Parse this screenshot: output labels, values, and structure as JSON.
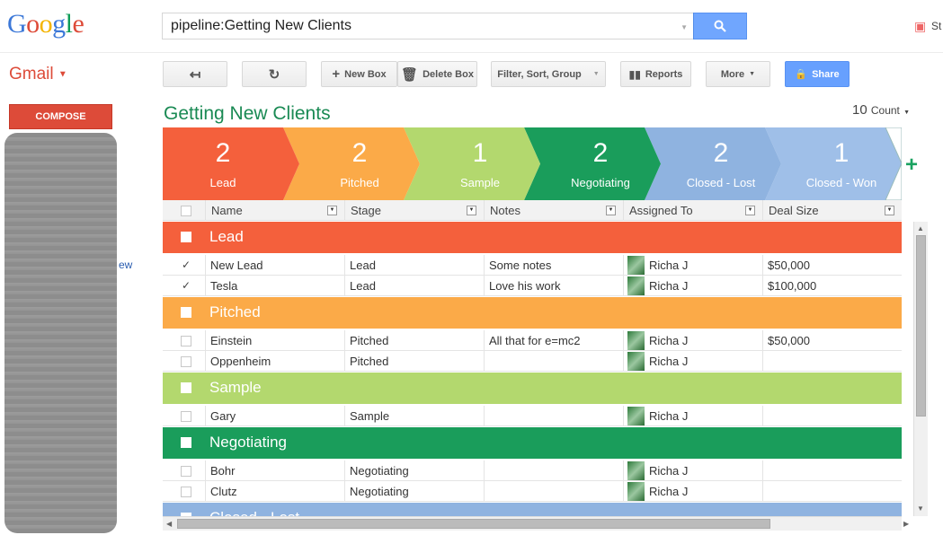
{
  "header": {
    "logo_letters": [
      {
        "ch": "G",
        "color": "#3c78d8"
      },
      {
        "ch": "o",
        "color": "#dd4b39"
      },
      {
        "ch": "o",
        "color": "#f4b400"
      },
      {
        "ch": "g",
        "color": "#3c78d8"
      },
      {
        "ch": "l",
        "color": "#0f9d58"
      },
      {
        "ch": "e",
        "color": "#dd4b39"
      }
    ],
    "search_value": "pipeline:Getting New Clients",
    "top_right_text": "St"
  },
  "sidebar": {
    "gmail_label": "Gmail",
    "compose_label": "COMPOSE",
    "side_fragment": "ew"
  },
  "toolbar": {
    "new_box": "New Box",
    "delete_box": "Delete Box",
    "filter": "Filter, Sort, Group",
    "reports": "Reports",
    "more": "More",
    "share": "Share"
  },
  "box": {
    "title": "Getting New Clients",
    "count_value": "10",
    "count_label": "Count"
  },
  "stages": [
    {
      "count": "2",
      "name": "Lead",
      "color": "#f4603c"
    },
    {
      "count": "2",
      "name": "Pitched",
      "color": "#fbaa48"
    },
    {
      "count": "1",
      "name": "Sample",
      "color": "#b3d86e"
    },
    {
      "count": "2",
      "name": "Negotiating",
      "color": "#1a9d5b"
    },
    {
      "count": "2",
      "name": "Closed - Lost",
      "color": "#8fb3e0"
    },
    {
      "count": "1",
      "name": "Closed - Won",
      "color": "#9fbfe8"
    }
  ],
  "columns": [
    "Name",
    "Stage",
    "Notes",
    "Assigned To",
    "Deal Size"
  ],
  "groups": [
    {
      "name": "Lead",
      "color": "#f4603c",
      "rows": [
        {
          "checked": true,
          "name": "New Lead",
          "stage": "Lead",
          "notes": "Some notes",
          "assigned": "Richa J",
          "deal": "$50,000"
        },
        {
          "checked": true,
          "name": "Tesla",
          "stage": "Lead",
          "notes": "Love his work",
          "assigned": "Richa J",
          "deal": "$100,000"
        }
      ]
    },
    {
      "name": "Pitched",
      "color": "#fbaa48",
      "rows": [
        {
          "checked": false,
          "name": "Einstein",
          "stage": "Pitched",
          "notes": "All that for e=mc2",
          "assigned": "Richa J",
          "deal": "$50,000"
        },
        {
          "checked": false,
          "name": "Oppenheim",
          "stage": "Pitched",
          "notes": "",
          "assigned": "Richa J",
          "deal": ""
        }
      ]
    },
    {
      "name": "Sample",
      "color": "#b3d86e",
      "rows": [
        {
          "checked": false,
          "name": "Gary",
          "stage": "Sample",
          "notes": "",
          "assigned": "Richa J",
          "deal": ""
        }
      ]
    },
    {
      "name": "Negotiating",
      "color": "#1a9d5b",
      "rows": [
        {
          "checked": false,
          "name": "Bohr",
          "stage": "Negotiating",
          "notes": "",
          "assigned": "Richa J",
          "deal": ""
        },
        {
          "checked": false,
          "name": "Clutz",
          "stage": "Negotiating",
          "notes": "",
          "assigned": "Richa J",
          "deal": ""
        }
      ]
    },
    {
      "name": "Closed - Lost",
      "color": "#8fb3e0",
      "rows": []
    }
  ]
}
